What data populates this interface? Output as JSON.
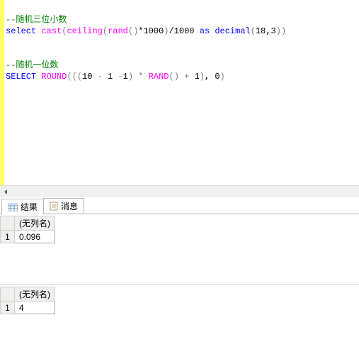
{
  "editor": {
    "l1": "--随机三位小数",
    "l2_select": "select",
    "l2_cast": "cast",
    "l2_ceiling": "ceiling",
    "l2_rand": "rand",
    "l2_num1": "*1000",
    "l2_num2": "/1000",
    "l2_as": "as",
    "l2_decimal": "decimal",
    "l2_args": "18,3",
    "l4": "--随机一位数",
    "l5_select": "SELECT",
    "l5_round": "ROUND",
    "l5_expr_a": "10 ",
    "l5_op1": "-",
    "l5_expr_b": " 1 ",
    "l5_op2": "-",
    "l5_expr_c": "1",
    "l5_star": " * ",
    "l5_rand": "RAND",
    "l5_plus": " + ",
    "l5_one": "1",
    "l5_comma": ", 0"
  },
  "tabs": {
    "results": "结果",
    "messages": "消息"
  },
  "grid1": {
    "header": "(无列名)",
    "row1_num": "1",
    "row1_val": "0.096"
  },
  "grid2": {
    "header": "(无列名)",
    "row1_num": "1",
    "row1_val": "4"
  }
}
